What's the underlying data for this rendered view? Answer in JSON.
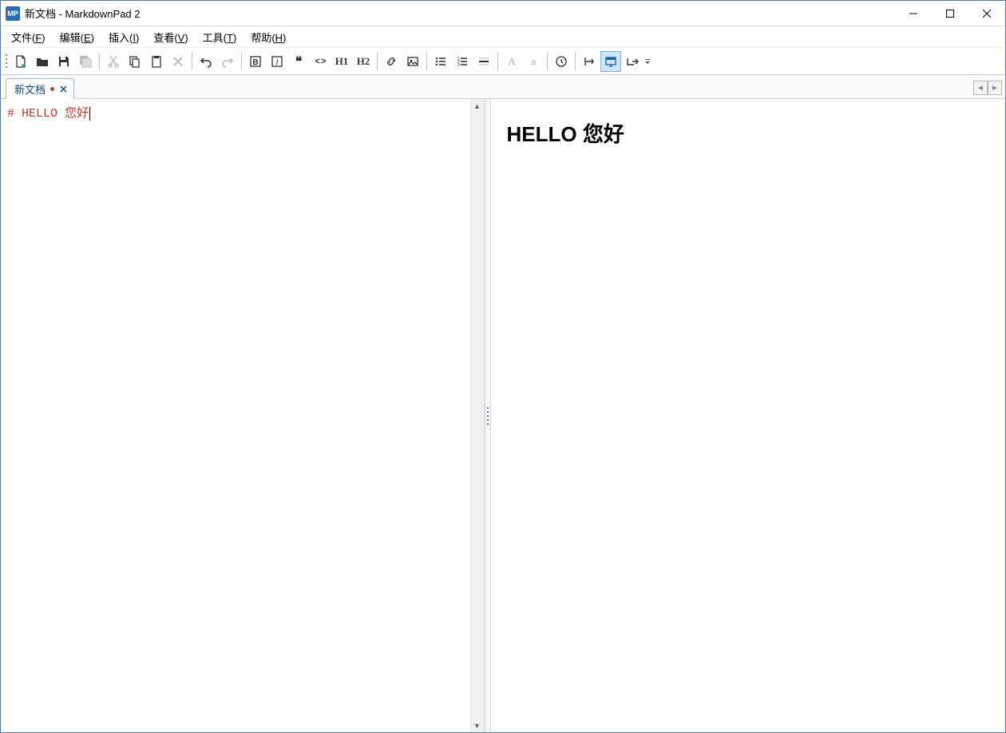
{
  "window": {
    "title": "新文档 - MarkdownPad 2",
    "app_icon_text": "MP"
  },
  "menu": {
    "file": "文件(F)",
    "edit": "编辑(E)",
    "insert": "插入(I)",
    "view": "查看(V)",
    "tools": "工具(T)",
    "help": "帮助(H)"
  },
  "toolbar": {
    "h1": "H1",
    "h2": "H2",
    "uppercase_a": "A",
    "lowercase_a": "a",
    "bold_b": "B",
    "italic_i": "I",
    "quote_mark": "❝",
    "code_mark": "< >"
  },
  "tabs": {
    "items": [
      {
        "label": "新文档",
        "dirty": true
      }
    ]
  },
  "editor": {
    "content": "# HELLO 您好"
  },
  "preview": {
    "heading": "HELLO 您好"
  }
}
